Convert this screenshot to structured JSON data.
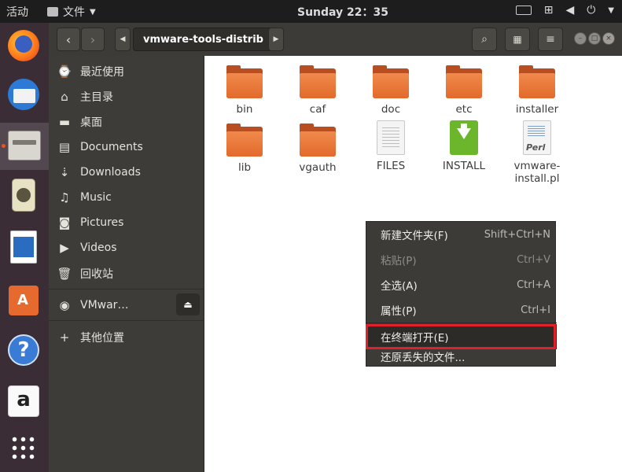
{
  "topbar": {
    "activities": "活动",
    "app_name": "文件",
    "clock": "Sunday 22：35"
  },
  "dock": {
    "items": [
      {
        "name": "firefox-icon"
      },
      {
        "name": "thunderbird-icon"
      },
      {
        "name": "files-icon"
      },
      {
        "name": "rhythmbox-icon"
      },
      {
        "name": "libreoffice-writer-icon"
      },
      {
        "name": "software-center-icon"
      },
      {
        "name": "help-icon"
      },
      {
        "name": "amazon-icon"
      },
      {
        "name": "app-grid-icon"
      }
    ]
  },
  "header": {
    "path": "vmware-tools-distrib"
  },
  "sidebar": {
    "items": [
      {
        "icon": "⌚",
        "label": "最近使用"
      },
      {
        "icon": "⌂",
        "label": "主目录"
      },
      {
        "icon": "▬",
        "label": "桌面"
      },
      {
        "icon": "▤",
        "label": "Documents"
      },
      {
        "icon": "⇣",
        "label": "Downloads"
      },
      {
        "icon": "♫",
        "label": "Music"
      },
      {
        "icon": "◙",
        "label": "Pictures"
      },
      {
        "icon": "▶",
        "label": "Videos"
      },
      {
        "icon": "🗑",
        "label": "回收站"
      },
      {
        "icon": "◉",
        "label": "VMwar…"
      },
      {
        "icon": "+",
        "label": "其他位置"
      }
    ]
  },
  "files": [
    {
      "label": "bin",
      "kind": "folder"
    },
    {
      "label": "caf",
      "kind": "folder"
    },
    {
      "label": "doc",
      "kind": "folder"
    },
    {
      "label": "etc",
      "kind": "folder"
    },
    {
      "label": "installer",
      "kind": "folder"
    },
    {
      "label": "lib",
      "kind": "folder"
    },
    {
      "label": "vgauth",
      "kind": "folder"
    },
    {
      "label": "FILES",
      "kind": "text"
    },
    {
      "label": "INSTALL",
      "kind": "install"
    },
    {
      "label": "vmware-install.pl",
      "kind": "perl"
    }
  ],
  "perl_icon_label": "Perl",
  "context_menu": {
    "items": [
      {
        "label": "新建文件夹(F)",
        "accel": "Shift+Ctrl+N",
        "disabled": false
      },
      {
        "label": "粘贴(P)",
        "accel": "Ctrl+V",
        "disabled": true
      },
      {
        "label": "全选(A)",
        "accel": "Ctrl+A",
        "disabled": false
      },
      {
        "label": "属性(P)",
        "accel": "Ctrl+I",
        "disabled": false
      },
      {
        "label": "在终端打开(E)",
        "accel": "",
        "disabled": false
      },
      {
        "label": "还原丢失的文件...",
        "accel": "",
        "disabled": false
      }
    ]
  },
  "colors": {
    "accent": "#e95420",
    "highlight_box": "#e0202a"
  }
}
